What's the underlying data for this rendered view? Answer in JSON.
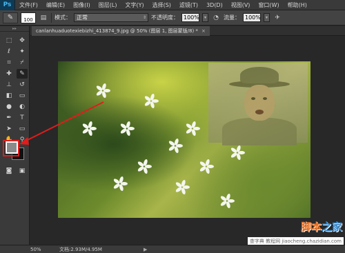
{
  "app": {
    "logo": "Ps"
  },
  "menu": [
    "文件(F)",
    "编辑(E)",
    "图像(I)",
    "图层(L)",
    "文字(Y)",
    "选择(S)",
    "滤镜(T)",
    "3D(D)",
    "视图(V)",
    "窗口(W)",
    "帮助(H)"
  ],
  "options": {
    "brush_size": "100",
    "mode_label": "模式：",
    "mode_value": "正常",
    "opacity_label": "不透明度：",
    "opacity_value": "100%",
    "flow_label": "流量：",
    "flow_value": "100%"
  },
  "document": {
    "tab_title": "canlanhuaduotexiebizhi_413874_9.jpg @ 50% (图层 1, 图层蒙版/8) *",
    "close": "×"
  },
  "status": {
    "zoom": "50%",
    "doc_info": "文档:2.93M/4.95M",
    "arrow": "▶"
  },
  "watermark": {
    "line1_a": "脚本",
    "line1_b": "之家",
    "line2": "查字典 教程网 jiaocheng.chazidian.com"
  },
  "colors": {
    "foreground": "#8a8a8a",
    "background": "#111111",
    "annotation": "#e31b1b"
  }
}
